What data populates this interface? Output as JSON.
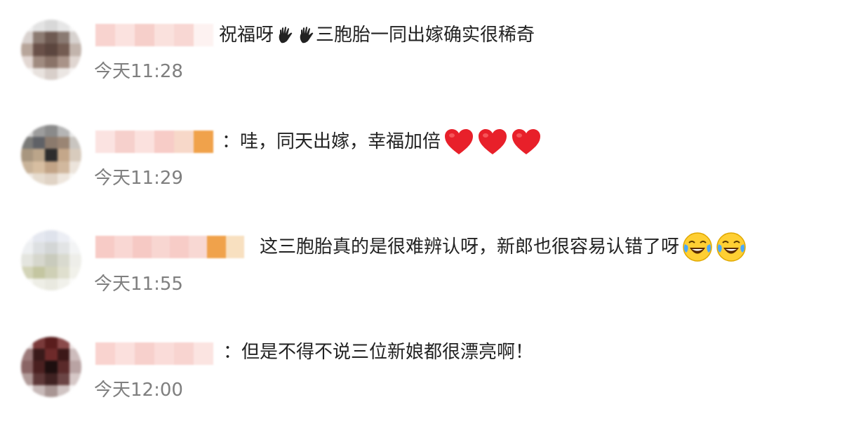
{
  "comments": [
    {
      "text": "祝福呀",
      "text2": "三胞胎一同出嫁确实很稀奇",
      "time": "今天11:28",
      "emoji_before_text2": [
        "hand-icon",
        "hand-icon"
      ],
      "emoji_after": []
    },
    {
      "text": "：哇，同天出嫁，幸福加倍",
      "text2": "",
      "time": "今天11:29",
      "emoji_before_text2": [],
      "emoji_after": [
        "heart-icon",
        "heart-icon",
        "heart-icon"
      ]
    },
    {
      "text": "这三胞胎真的是很难辨认呀，新郎也很容易认错了呀",
      "text2": "",
      "time": "今天11:55",
      "emoji_before_text2": [],
      "emoji_after": [
        "laugh-cry-icon",
        "laugh-cry-icon"
      ]
    },
    {
      "text": "：但是不得不说三位新娘都很漂亮啊！",
      "text2": "",
      "time": "今天12:00",
      "emoji_before_text2": [],
      "emoji_after": []
    }
  ],
  "colors": {
    "text": "#222222",
    "time": "#7f7f7f",
    "heart": "#e8202a",
    "laugh_face": "#ffcf33",
    "blurred_name_pink": "#f9d6d3",
    "blurred_name_orange": "#f0a24b"
  }
}
